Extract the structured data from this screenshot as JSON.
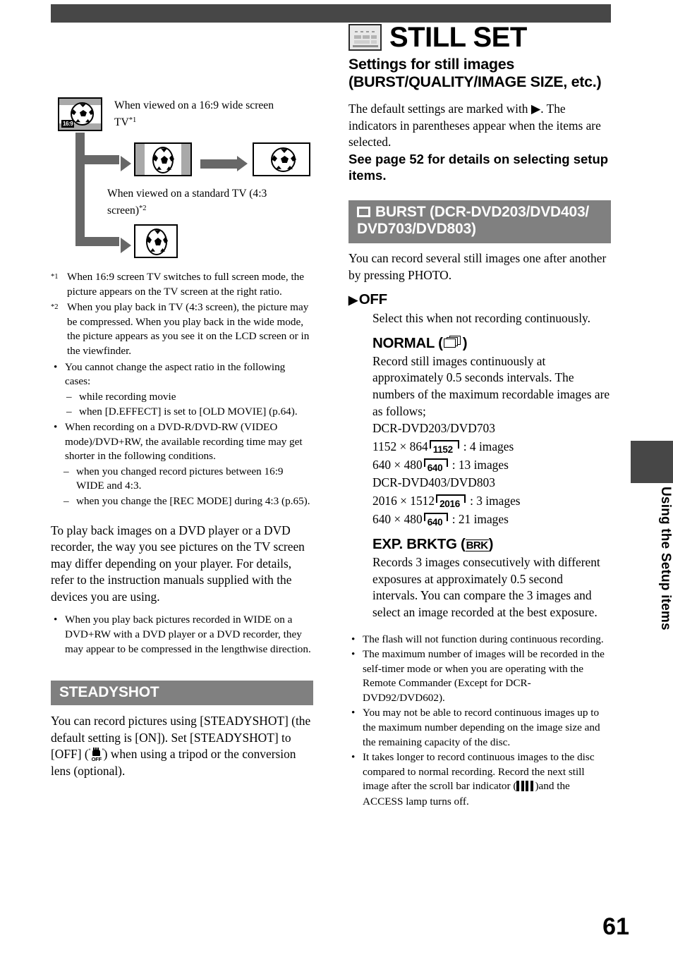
{
  "page": {
    "number": "61",
    "side_tab_label": "Using the Setup items"
  },
  "left_column": {
    "diagram": {
      "source_badge": "16:9",
      "label_wide": "When viewed on a 16:9 wide screen TV",
      "label_wide_sup": "*1",
      "label_standard": "When viewed on a standard TV (4:3 screen)",
      "label_standard_sup": "*2"
    },
    "footnotes": [
      {
        "mark": "*1",
        "text": "When 16:9 screen TV switches to full screen mode, the picture appears on the TV screen at the right ratio."
      },
      {
        "mark": "*2",
        "text": "When you play back in TV (4:3 screen), the picture may be compressed. When you play back in the wide mode, the picture appears as you see it on the LCD screen or in the viewfinder."
      }
    ],
    "bullets": [
      {
        "text": "You cannot change the aspect ratio in the following cases:",
        "sub": [
          "while recording movie",
          "when [D.EFFECT] is set to [OLD MOVIE] (p.64)."
        ]
      },
      {
        "text": "When recording on a DVD-R/DVD-RW (VIDEO mode)/DVD+RW, the available recording time may get shorter in the following conditions.",
        "sub": [
          "when you changed record pictures between 16:9 WIDE and 4:3.",
          "when you change the [REC MODE] during 4:3 (p.65)."
        ]
      }
    ],
    "paragraph": "To play back images on a DVD player or a DVD recorder, the way you see pictures on the TV screen may differ depending on your player. For details, refer to the instruction manuals supplied with the devices you are using.",
    "bullet_wide": "When you play back pictures recorded in WIDE on a DVD+RW with a DVD player or a DVD recorder, they may appear to be compressed in the lengthwise direction.",
    "steadyshot": {
      "header": "STEADYSHOT",
      "body_part1": "You can record pictures using [STEADYSHOT] (the default setting is [ON]). Set [STEADYSHOT] to [OFF] (",
      "icon_off_label": "OFF",
      "body_part2": ") when using a tripod or the conversion lens (optional)."
    }
  },
  "right_column": {
    "title": "STILL SET",
    "subtitle_line1": "Settings for still images",
    "subtitle_line2": "(BURST/QUALITY/IMAGE SIZE, etc.)",
    "intro": "The default settings are marked with ▶. The indicators in parentheses appear when the items are selected.",
    "see_page": "See page 52 for details on selecting setup items.",
    "burst": {
      "header_line1": "BURST (DCR-DVD203/DVD403/",
      "header_line2": "DVD703/DVD803)",
      "intro": "You can record several still images one after another by pressing PHOTO.",
      "options": [
        {
          "marker": "▶",
          "label": "OFF",
          "body": "Select this when not recording continuously."
        },
        {
          "label_prefix": "NORMAL (",
          "icon": "stacked-images-icon",
          "label_suffix": ")",
          "body": "Record still images continuously at approximately 0.5 seconds intervals. The numbers of the maximum recordable images are as follows;",
          "models": [
            {
              "name": "DCR-DVD203/DVD703",
              "sizes": [
                {
                  "dimensions": "1152 × 864",
                  "icon_num": "1152",
                  "result": ": 4 images"
                },
                {
                  "dimensions": "640 × 480",
                  "icon_num": "640",
                  "result": ": 13 images"
                }
              ]
            },
            {
              "name": "DCR-DVD403/DVD803",
              "sizes": [
                {
                  "dimensions": "2016 × 1512",
                  "icon_num": "2016",
                  "result": ": 3 images"
                },
                {
                  "dimensions": "640 × 480",
                  "icon_num": "640",
                  "result": ": 21 images"
                }
              ]
            }
          ]
        },
        {
          "label_prefix": "EXP. BRKTG (",
          "icon_text": "BRK",
          "label_suffix": ")",
          "body": "Records 3 images consecutively with different exposures at approximately 0.5 second intervals. You can compare the 3 images and select an image recorded at the best exposure."
        }
      ],
      "notes": [
        "The flash will not function during continuous recording.",
        "The maximum number of images will be recorded in the self-timer mode or when you are operating with the Remote Commander (Except for DCR-DVD92/DVD602).",
        "You may not be able to record continuous images up to the maximum number depending on the image size and the remaining capacity of the disc."
      ],
      "note_last_part1": "It takes longer to record continuous images to the disc compared to normal recording. Record the next still image after the scroll bar indicator (",
      "note_last_part2": ")and the ACCESS lamp turns off."
    }
  }
}
